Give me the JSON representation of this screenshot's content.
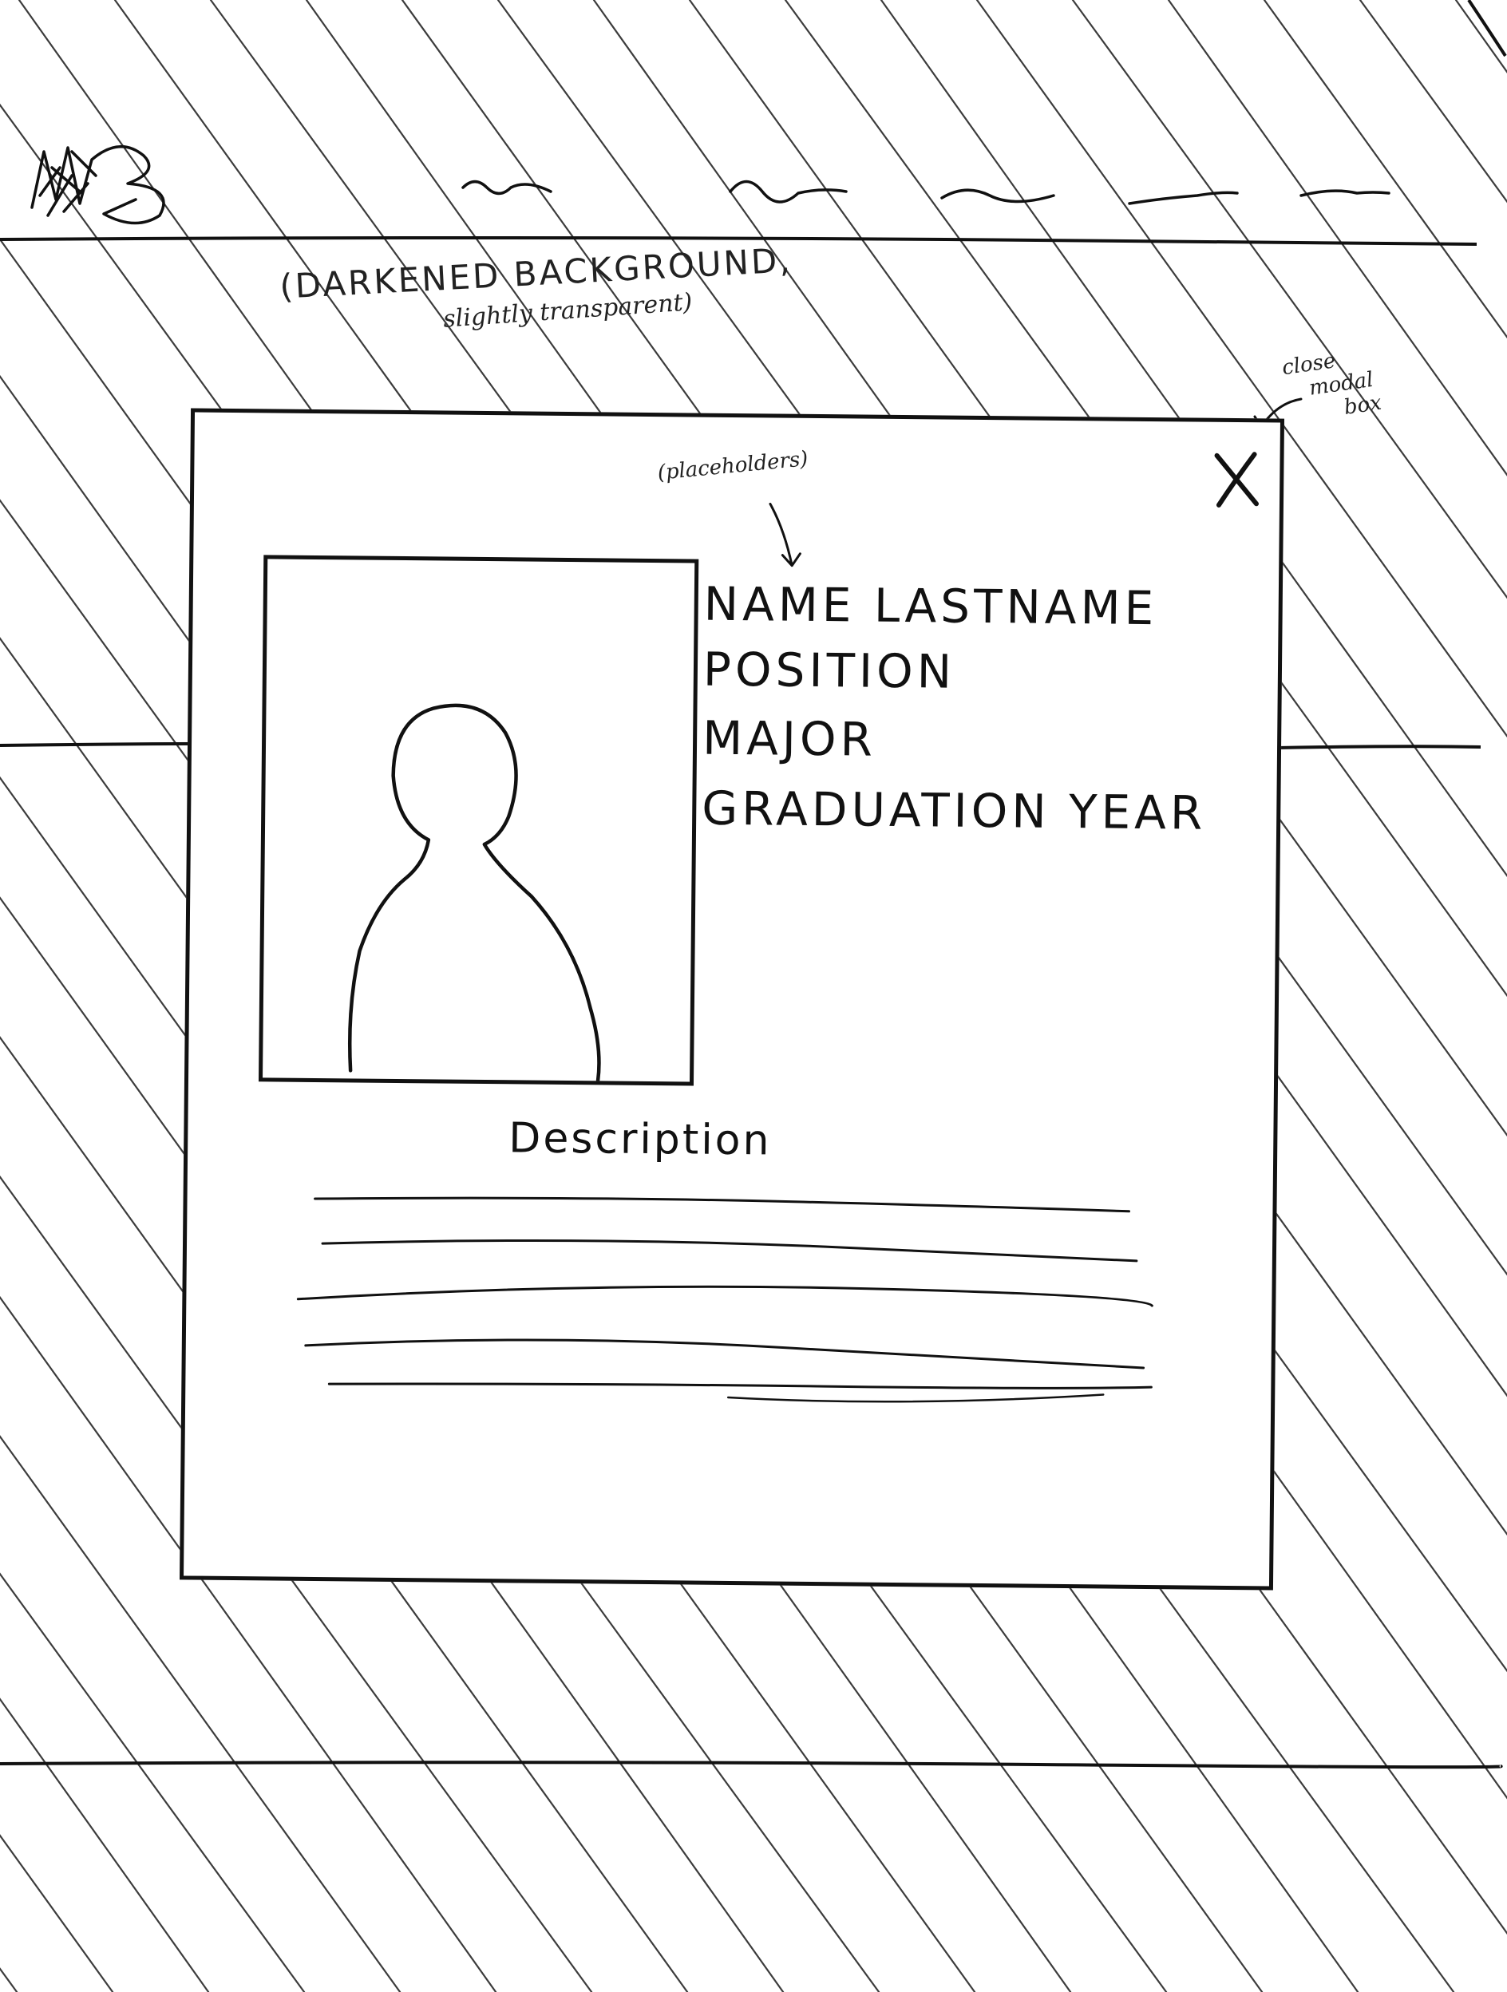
{
  "background": {
    "annotation_line1": "(DARKENED BACKGROUND,",
    "annotation_line2": "slightly transparent)"
  },
  "modal": {
    "placeholders_note": "(placeholders)",
    "close_note_line1": "close",
    "close_note_line2": "modal",
    "close_note_line3": "box",
    "close_symbol": "X",
    "name": "NAME LASTNAME",
    "position": "POSITION",
    "major": "MAJOR",
    "graduation_year": "GRADUATION YEAR",
    "description_label": "Description"
  },
  "colors": {
    "ink": "#111111",
    "paper": "#ffffff"
  }
}
